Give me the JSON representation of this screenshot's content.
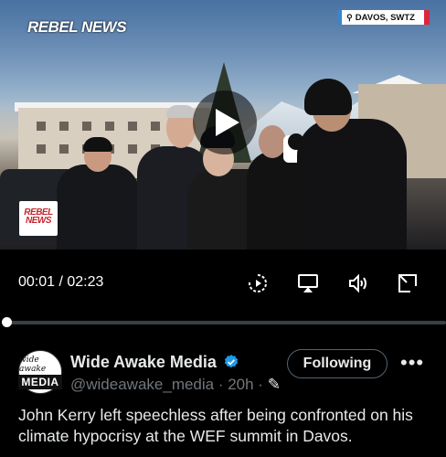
{
  "video": {
    "logo_main": "REBEL NEWS",
    "logo_small": "REBEL NEWS",
    "location": "DAVOS, SWTZ",
    "colors": {
      "location_left": "#3a86c8",
      "location_right": "#d9283c"
    }
  },
  "controls": {
    "time": "00:01 / 02:23",
    "progress": 0.007,
    "icons": [
      "playback-speed-icon",
      "airplay-icon",
      "volume-icon",
      "pop-out-icon"
    ]
  },
  "tweet": {
    "avatar_line1": "wide awake",
    "avatar_line2": "MEDIA",
    "name": "Wide Awake Media",
    "handle": "@wideawake_media · 20h ·",
    "follow_label": "Following",
    "more_label": "•••",
    "text": "John Kerry left speechless after being confronted on his climate hypocrisy at the WEF summit in Davos.",
    "colors": {
      "verified": "#1d9bf0",
      "secondary_text": "#71767b"
    }
  }
}
